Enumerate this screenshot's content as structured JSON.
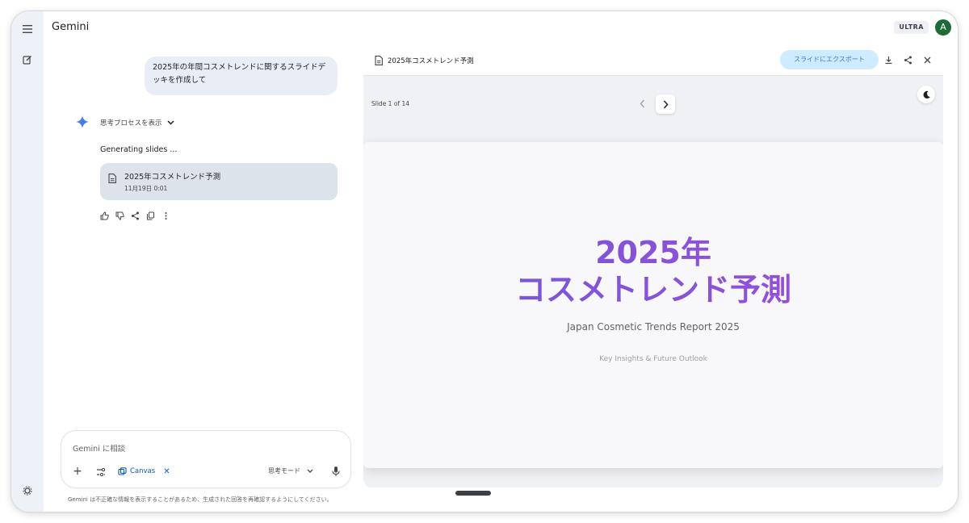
{
  "app": {
    "title": "Gemini",
    "plan_badge": "ULTRA",
    "avatar_initial": "A"
  },
  "rail": {
    "menu_icon": "menu-icon",
    "new_chat_icon": "edit-icon",
    "settings_icon": "gear-icon"
  },
  "chat": {
    "user_message": "2025年の年間コスメトレンドに関するスライドデッキを作成して",
    "thinking_label": "思考プロセスを表示",
    "status": "Generating slides ...",
    "doc_card": {
      "title": "2025年コスメトレンド予測",
      "date": "11月19日 0:01"
    }
  },
  "composer": {
    "placeholder": "Gemini に相談",
    "canvas_chip": "Canvas",
    "mode": "思考モード",
    "disclaimer": "Gemini は不正確な情報を表示することがあるため、生成された回答を再確認するようにしてください。"
  },
  "canvas_panel": {
    "title": "2025年コスメトレンド予測",
    "export_label": "スライドにエクスポート",
    "slide_counter": "Slide 1 of 14",
    "slide": {
      "title_line1": "2025年",
      "title_line2": "コスメトレンド予測",
      "subtitle": "Japan Cosmetic Trends Report 2025",
      "tagline": "Key Insights & Future Outlook"
    }
  },
  "colors": {
    "accent_blue": "#0b57d0",
    "export_bg": "#c2e7ff",
    "title_gradient_start": "#6d5bd8",
    "title_gradient_end": "#a24ad7",
    "avatar_bg": "#1e6b35"
  }
}
